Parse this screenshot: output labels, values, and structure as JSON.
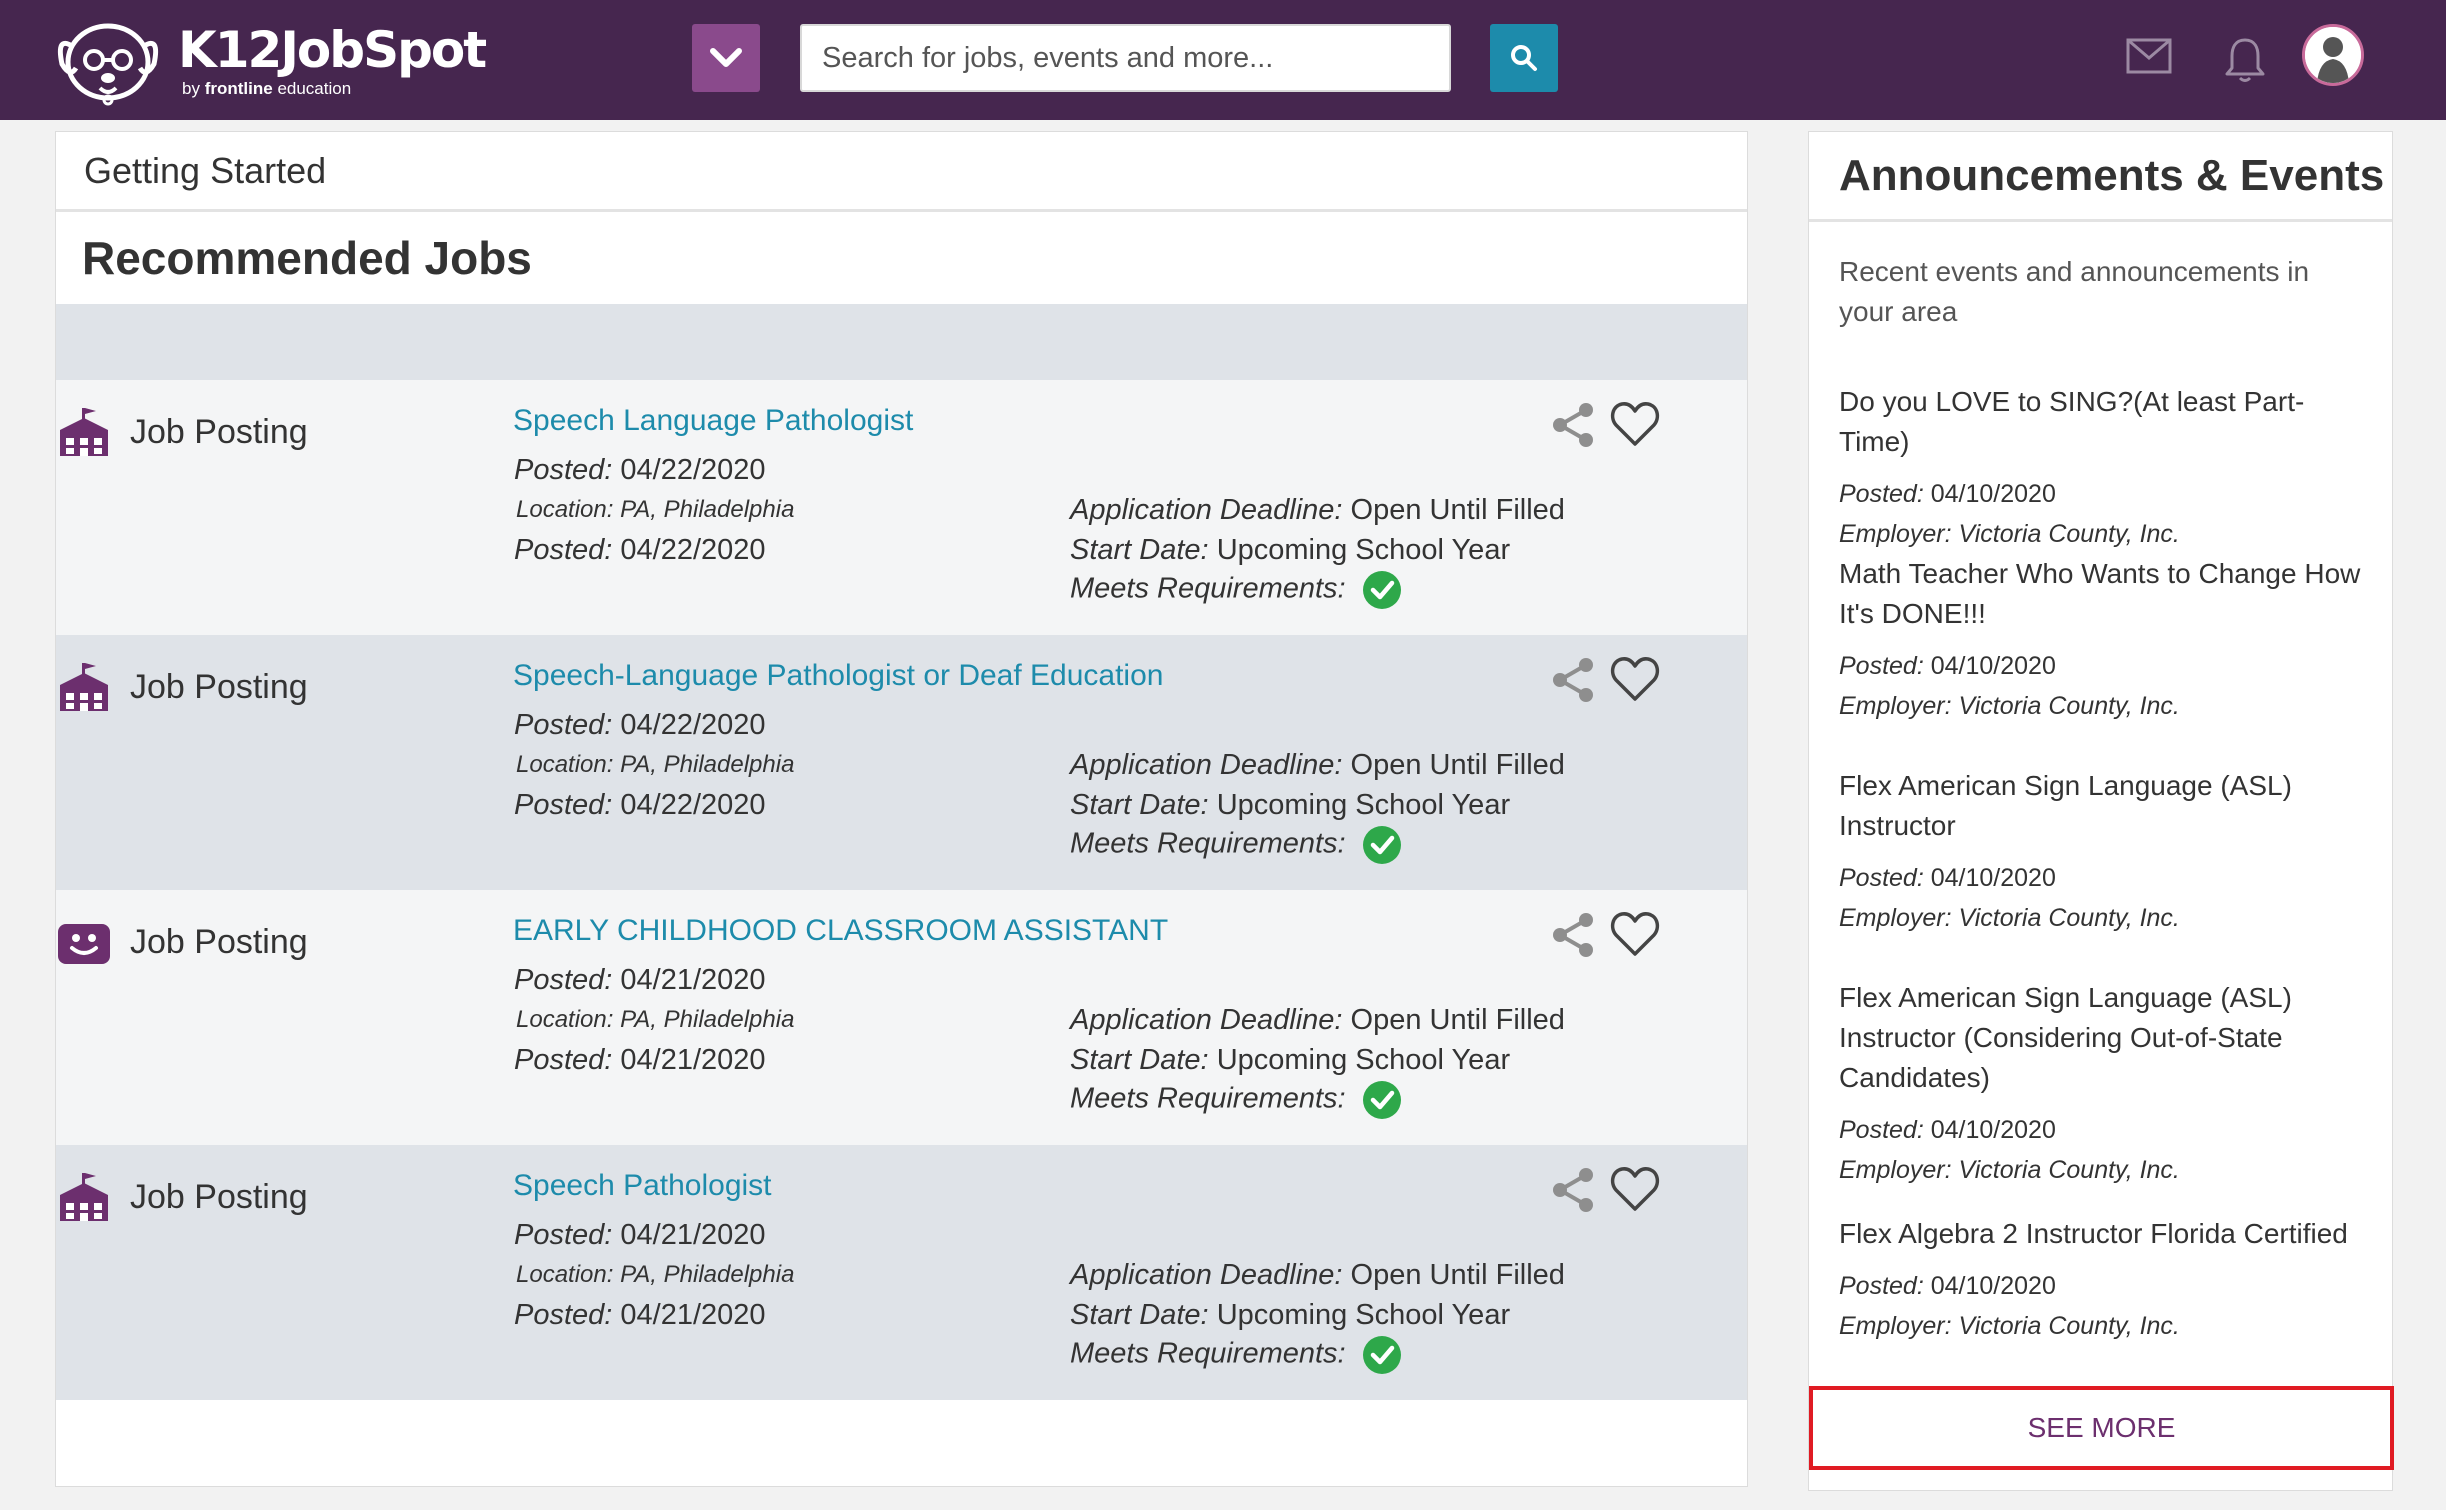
{
  "header": {
    "logo_name": "K12JobSpot",
    "logo_by": "by",
    "logo_brand": "frontline",
    "logo_brand_suffix": "education",
    "search_placeholder": "Search for jobs, events and more...",
    "brand_color": "#46264f",
    "dropdown_color": "#8a4a8c",
    "search_button_color": "#1d8bab"
  },
  "main": {
    "getting_started": "Getting Started",
    "recommended_title": "Recommended Jobs",
    "jobs": [
      {
        "type_label": "Job Posting",
        "type_icon": "school-building-icon",
        "title": "Speech Language Pathologist",
        "posted_label": "Posted:",
        "posted": "04/22/2020",
        "location": "Location: PA, Philadelphia",
        "posted2": "04/22/2020",
        "deadline_label": "Application Deadline:",
        "deadline": "Open Until Filled",
        "start_label": "Start Date:",
        "start": "Upcoming School Year",
        "meets_label": "Meets Requirements:"
      },
      {
        "type_label": "Job Posting",
        "type_icon": "school-building-icon",
        "title": "Speech-Language Pathologist or Deaf Education",
        "posted_label": "Posted:",
        "posted": "04/22/2020",
        "location": "Location: PA, Philadelphia",
        "posted2": "04/22/2020",
        "deadline_label": "Application Deadline:",
        "deadline": "Open Until Filled",
        "start_label": "Start Date:",
        "start": "Upcoming School Year",
        "meets_label": "Meets Requirements:"
      },
      {
        "type_label": "Job Posting",
        "type_icon": "smiley-face-icon",
        "title": "EARLY CHILDHOOD CLASSROOM ASSISTANT",
        "posted_label": "Posted:",
        "posted": "04/21/2020",
        "location": "Location: PA, Philadelphia",
        "posted2": "04/21/2020",
        "deadline_label": "Application Deadline:",
        "deadline": "Open Until Filled",
        "start_label": "Start Date:",
        "start": "Upcoming School Year",
        "meets_label": "Meets Requirements:"
      },
      {
        "type_label": "Job Posting",
        "type_icon": "school-building-icon",
        "title": "Speech Pathologist",
        "posted_label": "Posted:",
        "posted": "04/21/2020",
        "location": "Location: PA, Philadelphia",
        "posted2": "04/21/2020",
        "deadline_label": "Application Deadline:",
        "deadline": "Open Until Filled",
        "start_label": "Start Date:",
        "start": "Upcoming School Year",
        "meets_label": "Meets Requirements:"
      }
    ]
  },
  "sidebar": {
    "title": "Announcements & Events",
    "description": "Recent events and announcements in your area",
    "items": [
      {
        "title": "Do you LOVE to SING?(At least Part-Time)",
        "posted_label": "Posted:",
        "posted": "04/10/2020",
        "employer": "Employer: Victoria County, Inc."
      },
      {
        "title": "Math Teacher Who Wants to Change How It's DONE!!!",
        "posted_label": "Posted:",
        "posted": "04/10/2020",
        "employer": "Employer: Victoria County, Inc."
      },
      {
        "title": "Flex American Sign Language (ASL) Instructor",
        "posted_label": "Posted:",
        "posted": "04/10/2020",
        "employer": "Employer: Victoria County, Inc."
      },
      {
        "title": "Flex American Sign Language (ASL) Instructor (Considering Out-of-State Candidates)",
        "posted_label": "Posted:",
        "posted": "04/10/2020",
        "employer": "Employer: Victoria County, Inc."
      },
      {
        "title": "Flex Algebra 2 Instructor Florida Certified",
        "posted_label": "Posted:",
        "posted": "04/10/2020",
        "employer": "Employer: Victoria County, Inc."
      }
    ],
    "see_more": "SEE MORE"
  }
}
